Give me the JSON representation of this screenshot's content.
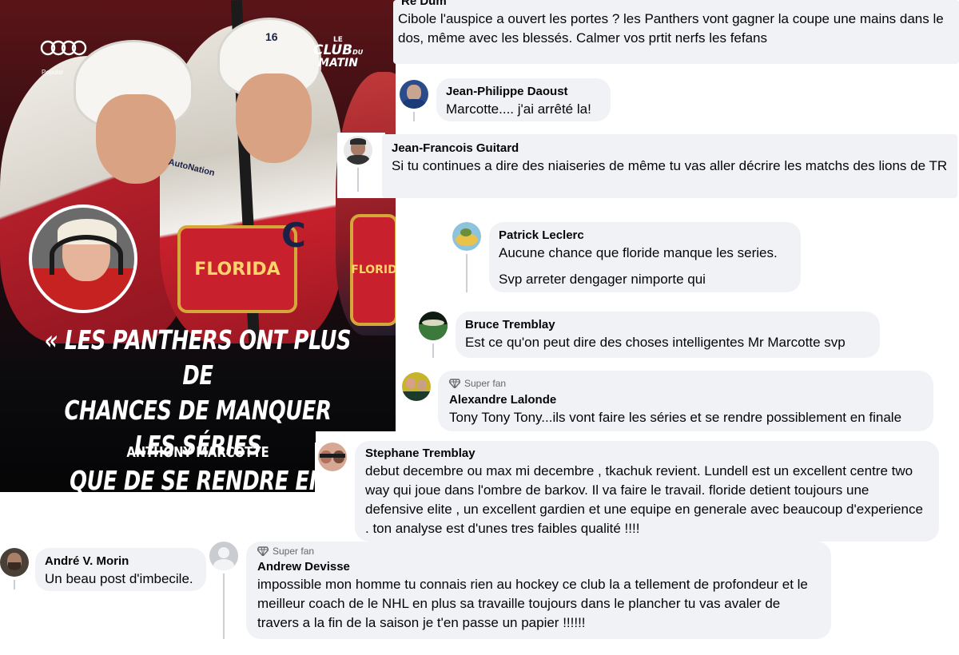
{
  "post_image": {
    "brand_caption": "Popular",
    "show_logo": {
      "small": "LE",
      "line1": "CLUB",
      "superscript": "DU",
      "line2": "MATIN"
    },
    "jersey_number": "16",
    "sponsor": "AutoNation",
    "crest_text": "FLORIDA",
    "crest_text_right": "FLORID",
    "captain_letter": "C",
    "quote": "« LES PANTHERS ONT PLUS DE CHANCES DE MANQUER LES SÉRIES QUE DE SE RENDRE EN FINALE! »",
    "quote_lines": [
      "« LES PANTHERS ONT PLUS DE",
      "CHANCES DE MANQUER LES SÉRIES",
      "QUE DE SE RENDRE EN FINALE! »"
    ],
    "author": "ANTHONY MARCOTTE"
  },
  "comments": [
    {
      "author": "Re Dum",
      "text": "Cibole l'auspice a ouvert les portes ? les Panthers vont gagner la coupe une mains dans le dos, même avec les blessés. Calmer vos prtit nerfs les fefans"
    },
    {
      "author": "Jean-Philippe Daoust",
      "text": "Marcotte.... j'ai arrêté la!"
    },
    {
      "author": "Jean-Francois Guitard",
      "text": "Si tu continues a dire des niaiseries de même tu vas aller décrire les matchs des lions de TR"
    },
    {
      "author": "Patrick Leclerc",
      "text": "Aucune chance que floride manque les series.",
      "text2": "Svp arreter dengager nimporte qui"
    },
    {
      "author": "Bruce Tremblay",
      "text": "Est ce qu'on peut dire des choses intelligentes Mr Marcotte svp"
    },
    {
      "badge": "Super fan",
      "author": "Alexandre Lalonde",
      "text": "Tony Tony Tony...ils vont faire les séries et se rendre possiblement en finale"
    },
    {
      "author": "Stephane Tremblay",
      "text": "debut decembre ou max mi decembre , tkachuk revient. Lundell est un excellent centre two way qui joue dans l'ombre de barkov. Il va faire le travail. floride detient toujours une defensive elite , un excellent gardien et une equipe en generale avec beaucoup d'experience . ton analyse est d'unes tres faibles qualité !!!!"
    },
    {
      "author": "André V. Morin",
      "text": "Un beau post d'imbecile."
    },
    {
      "badge": "Super fan",
      "author": "Andrew Devisse",
      "text": "impossible mon homme tu connais rien au hockey ce club la a tellement de profondeur et le meilleur coach de le NHL en plus sa travaille toujours dans le plancher tu vas avaler de travers a la fin de la saison je t'en passe un papier !!!!!!"
    }
  ],
  "colors": {
    "bubble": "#f0f2f5",
    "text": "#050505",
    "muted": "#65676b",
    "thread": "#ccd0d5",
    "quote_bg": "#0b0b0e"
  },
  "icons": {
    "badge": "gem-icon",
    "brand": "audi-rings-icon"
  }
}
